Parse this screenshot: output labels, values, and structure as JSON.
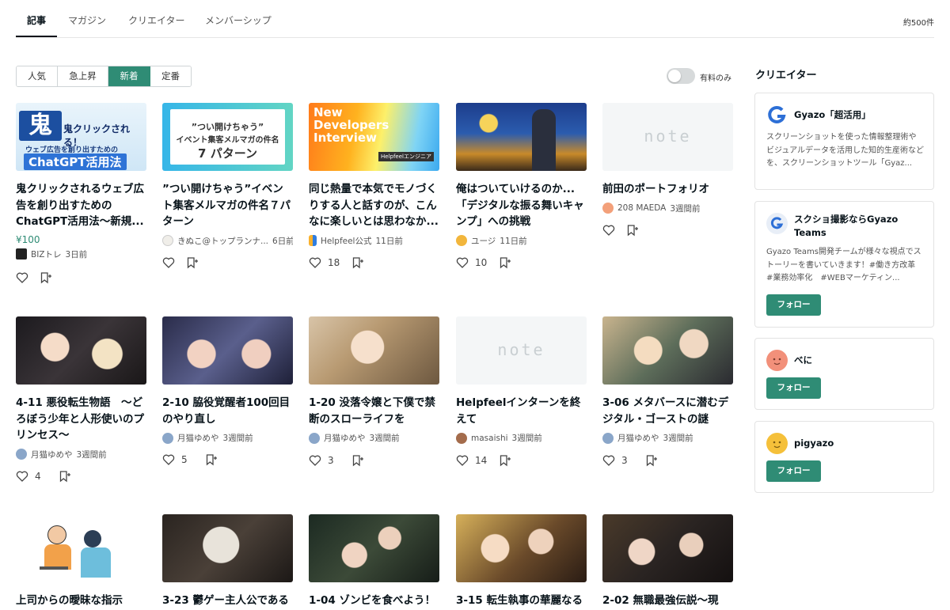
{
  "top_tabs": [
    "記事",
    "マガジン",
    "クリエイター",
    "メンバーシップ"
  ],
  "result_count": "約500件",
  "sort_tabs": [
    "人気",
    "急上昇",
    "新着",
    "定番"
  ],
  "paid_only_label": "有料のみ",
  "creators_section_title": "クリエイター",
  "articles": [
    {
      "title": "鬼クリックされるウェブ広告を創り出すための ChatGPT活用法〜新規...",
      "price": "¥100",
      "author": "BIZトレ",
      "time": "3日前",
      "likes": "",
      "thumb_text": [
        "鬼クリックされる！",
        "ウェブ広告を創り出すための",
        "ChatGPT活用法"
      ]
    },
    {
      "title": "”つい開けちゃう”イベント集客メルマガの件名７パターン",
      "price": "",
      "author": "きぬこ@トップランナ...",
      "time": "6日前",
      "likes": "",
      "thumb_text": [
        "”つい開けちゃう”",
        "イベント集客メルマガの件名",
        "7 パターン"
      ]
    },
    {
      "title": "同じ熱量で本気でモノづくりする人と話すのが、こんなに楽しいとは思わなか...",
      "price": "",
      "author": "Helpfeel公式",
      "time": "11日前",
      "likes": "18",
      "thumb_text": [
        "New",
        "Developers",
        "Interview",
        "Helpfeelエンジニア"
      ]
    },
    {
      "title": "俺はついていけるのか... 「デジタルな振る舞いキャンプ」への挑戦",
      "price": "",
      "author": "ユージ",
      "time": "11日前",
      "likes": "10",
      "thumb_text": []
    },
    {
      "title": "前田のポートフォリオ",
      "price": "",
      "author": "208 MAEDA",
      "time": "3週間前",
      "likes": "",
      "thumb_text": [
        "note"
      ]
    },
    {
      "title": "4-11 悪役転生物語　〜どろぼう少年と人形使いのプリンセス〜",
      "price": "",
      "author": "月猫ゆめや",
      "time": "3週間前",
      "likes": "4",
      "thumb_text": []
    },
    {
      "title": "2-10 脇役覚醒者100回目のやり直し",
      "price": "",
      "author": "月猫ゆめや",
      "time": "3週間前",
      "likes": "5",
      "thumb_text": []
    },
    {
      "title": "1-20 没落令嬢と下僕で禁断のスローライフを",
      "price": "",
      "author": "月猫ゆめや",
      "time": "3週間前",
      "likes": "3",
      "thumb_text": []
    },
    {
      "title": "Helpfeelインターンを終えて",
      "price": "",
      "author": "masaishi",
      "time": "3週間前",
      "likes": "14",
      "thumb_text": [
        "note"
      ]
    },
    {
      "title": "3-06 メタバースに潜むデジタル・ゴーストの謎",
      "price": "",
      "author": "月猫ゆめや",
      "time": "3週間前",
      "likes": "3",
      "thumb_text": []
    },
    {
      "title": "上司からの曖昧な指示",
      "price": "",
      "author": "",
      "time": "",
      "likes": "",
      "thumb_text": []
    },
    {
      "title": "3-23 鬱ゲー主人公である",
      "price": "",
      "author": "",
      "time": "",
      "likes": "",
      "thumb_text": []
    },
    {
      "title": "1-04 ゾンビを食べよう！",
      "price": "",
      "author": "",
      "time": "",
      "likes": "",
      "thumb_text": []
    },
    {
      "title": "3-15 転生執事の華麗なる",
      "price": "",
      "author": "",
      "time": "",
      "likes": "",
      "thumb_text": []
    },
    {
      "title": "2-02 無職最強伝説〜現",
      "price": "",
      "author": "",
      "time": "",
      "likes": "",
      "thumb_text": []
    }
  ],
  "creators": [
    {
      "name": "Gyazo「超活用」",
      "description": "スクリーンショットを使った情報整理術やビジュアルデータを活用した知的生産術などを、スクリーンショットツール「Gyaz...",
      "follow": ""
    },
    {
      "name": "スクショ撮影ならGyazo Teams",
      "description": "Gyazo Teams開発チームが様々な視点でストーリーを書いていきます！#働き方改革　#業務効率化　#WEBマーケティン...",
      "follow": "フォロー"
    },
    {
      "name": "べに",
      "description": "",
      "follow": "フォロー"
    },
    {
      "name": "pigyazo",
      "description": "",
      "follow": "フォロー"
    }
  ],
  "colors": {
    "accent": "#2f8c75",
    "text": "#08131a",
    "border": "#e3e3e3"
  }
}
